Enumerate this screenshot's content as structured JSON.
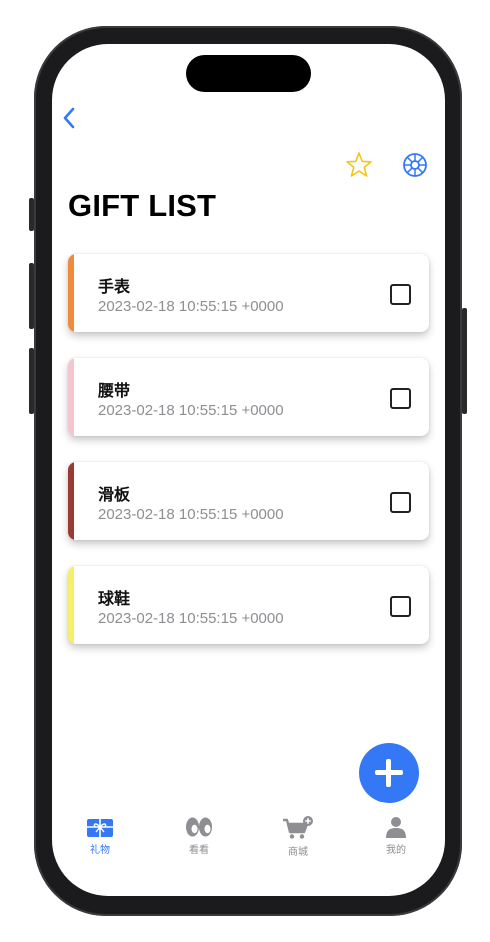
{
  "nav": {
    "back_icon": "chevron-left-icon",
    "favorites_icon": "star-outline-icon",
    "settings_icon": "gear-icon"
  },
  "page": {
    "title": "GIFT LIST"
  },
  "gifts": [
    {
      "name": "手表",
      "date": "2023-02-18 10:55:15 +0000",
      "color": "#f08a3c",
      "checked": false
    },
    {
      "name": "腰带",
      "date": "2023-02-18 10:55:15 +0000",
      "color": "#f5c6d0",
      "checked": false
    },
    {
      "name": "滑板",
      "date": "2023-02-18 10:55:15 +0000",
      "color": "#9a3a32",
      "checked": false
    },
    {
      "name": "球鞋",
      "date": "2023-02-18 10:55:15 +0000",
      "color": "#f7ef6a",
      "checked": false
    }
  ],
  "fab": {
    "icon": "plus-icon",
    "color": "#3478f6"
  },
  "tabs": [
    {
      "label": "礼物",
      "icon": "gift-icon",
      "active": true
    },
    {
      "label": "看看",
      "icon": "eyes-icon",
      "active": false
    },
    {
      "label": "商城",
      "icon": "cart-icon",
      "active": false
    },
    {
      "label": "我的",
      "icon": "person-icon",
      "active": false
    }
  ],
  "colors": {
    "accent": "#3478f6",
    "star": "#f5c518",
    "inactive": "#8e8e93"
  }
}
